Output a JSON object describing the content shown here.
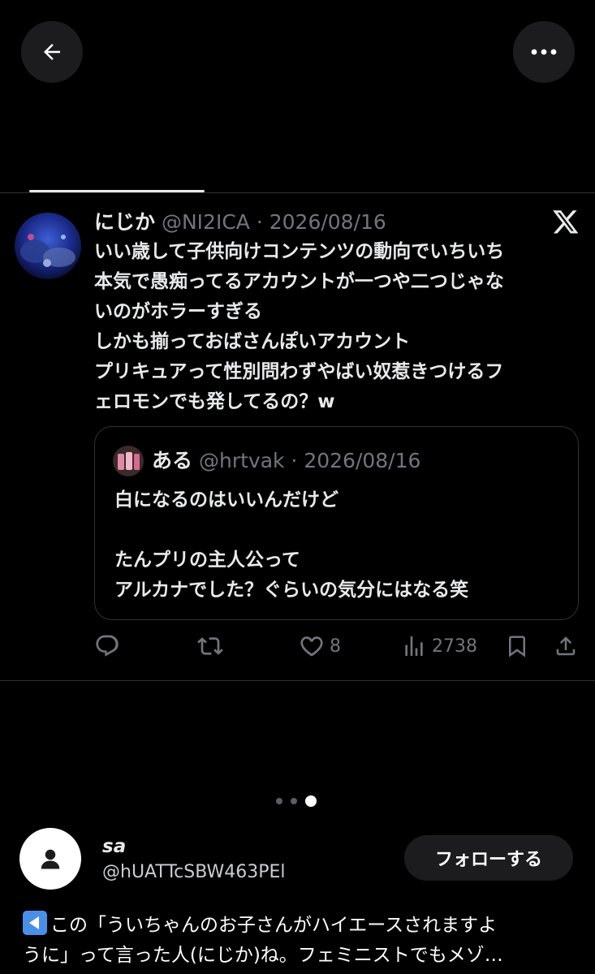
{
  "tweet": {
    "display_name": "にじか",
    "handle_date": "@NI2ICA · 2026/08/16",
    "lines": [
      "いい歳して子供向けコンテンツの動向でいちいち",
      "本気で愚痴ってるアカウントが一つや二つじゃな",
      "いのがホラーすぎる",
      "しかも揃っておばさんぽいアカウント",
      "プリキュアって性別問わずやばい奴惹きつけるフ",
      "ェロモンでも発してるの？w"
    ]
  },
  "quote": {
    "display_name": "ある",
    "handle_date": "@hrtvak · 2026/08/16",
    "lines": [
      "白になるのはいいんだけど",
      "",
      "たんプリの主人公って",
      "アルカナでした？ぐらいの気分にはなる笑"
    ]
  },
  "actions": {
    "likes": "8",
    "views": "2738"
  },
  "post": {
    "user_name": "sa",
    "user_handle": "@hUATTcSBW463PEl",
    "follow_label": "フォローする",
    "caption_line1": "この「ういちゃんのお子さんがハイエースされますよ",
    "caption_line2": "うに」って言った人(にじか)ね。フェミニストでもメゾ…"
  },
  "icons": [
    "arrow-left-icon",
    "more-horizontal-icon",
    "x-logo-icon",
    "reply-icon",
    "retweet-icon",
    "heart-icon",
    "views-chart-icon",
    "bookmark-icon",
    "share-icon",
    "user-icon",
    "left-arrow-emoji-icon"
  ]
}
